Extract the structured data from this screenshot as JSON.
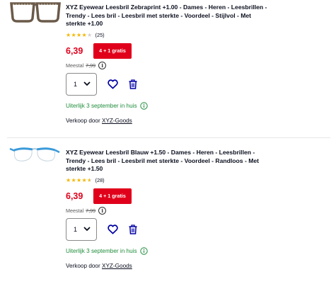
{
  "products": [
    {
      "title": "XYZ Eyewear Leesbril Zebraprint +1.00 - Dames - Heren - Leesbrillen - Trendy - Lees bril - Leesbril met sterkte - Voordeel - Stijlvol - Met sterkte +1.00",
      "rating": 4,
      "reviews": "(25)",
      "price": "6,39",
      "promo": "4 + 1 gratis",
      "old_price_label": "Meestal",
      "old_price": "7,99",
      "quantity": "1",
      "delivery": "Uiterlijk 3 september in huis",
      "seller_prefix": "Verkoop door",
      "seller_name": "XYZ-Goods",
      "frame_color": "#6b5a4a"
    },
    {
      "title": "XYZ Eyewear Leesbril Blauw +1.50 - Dames - Heren - Leesbrillen - Trendy - Lees bril - Leesbril met sterkte - Voordeel - Randloos - Met sterkte +1.50",
      "rating": 4.5,
      "reviews": "(28)",
      "price": "6,39",
      "promo": "4 + 1 gratis",
      "old_price_label": "Meestal",
      "old_price": "7,99",
      "quantity": "1",
      "delivery": "Uiterlijk 3 september in huis",
      "seller_prefix": "Verkoop door",
      "seller_name": "XYZ-Goods",
      "frame_color": "#3a9ad9"
    }
  ],
  "colors": {
    "price_red": "#e0001b",
    "delivery_green": "#1e8c3a",
    "wishlist_blue": "#0000a4",
    "star_gold": "#f5b700"
  },
  "icons": {
    "info": "info-icon",
    "wishlist": "heart-icon",
    "delete": "trash-icon",
    "dropdown": "chevron-down-icon",
    "delivery": "check-circle-icon"
  }
}
